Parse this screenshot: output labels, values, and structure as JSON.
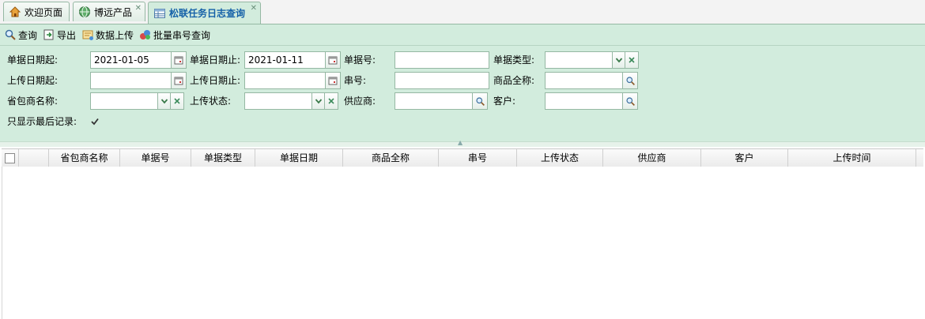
{
  "tabs": [
    {
      "label": "欢迎页面",
      "icon": "home-icon",
      "closable": false
    },
    {
      "label": "博远产品",
      "icon": "globe-icon",
      "closable": true
    },
    {
      "label": "松联任务日志查询",
      "icon": "table-icon",
      "closable": true,
      "active": true
    }
  ],
  "toolbar": {
    "query": "查询",
    "export": "导出",
    "upload": "数据上传",
    "batch": "批量串号查询"
  },
  "form": {
    "doc_date_from_label": "单据日期起:",
    "doc_date_from_value": "2021-01-05",
    "doc_date_to_label": "单据日期止:",
    "doc_date_to_value": "2021-01-11",
    "doc_no_label": "单据号:",
    "doc_type_label": "单据类型:",
    "upload_date_from_label": "上传日期起:",
    "upload_date_to_label": "上传日期止:",
    "serial_label": "串号:",
    "product_name_label": "商品全称:",
    "vendor_name_label": "省包商名称:",
    "upload_status_label": "上传状态:",
    "supplier_label": "供应商:",
    "customer_label": "客户:",
    "only_last_label": "只显示最后记录:",
    "only_last_checked": true
  },
  "grid": {
    "columns": [
      "省包商名称",
      "单据号",
      "单据类型",
      "单据日期",
      "商品全称",
      "串号",
      "上传状态",
      "供应商",
      "客户",
      "上传时间"
    ]
  },
  "colors": {
    "panel_bg": "#d2ecdd",
    "active_tab_text": "#1460a8",
    "border": "#95b8a3"
  }
}
